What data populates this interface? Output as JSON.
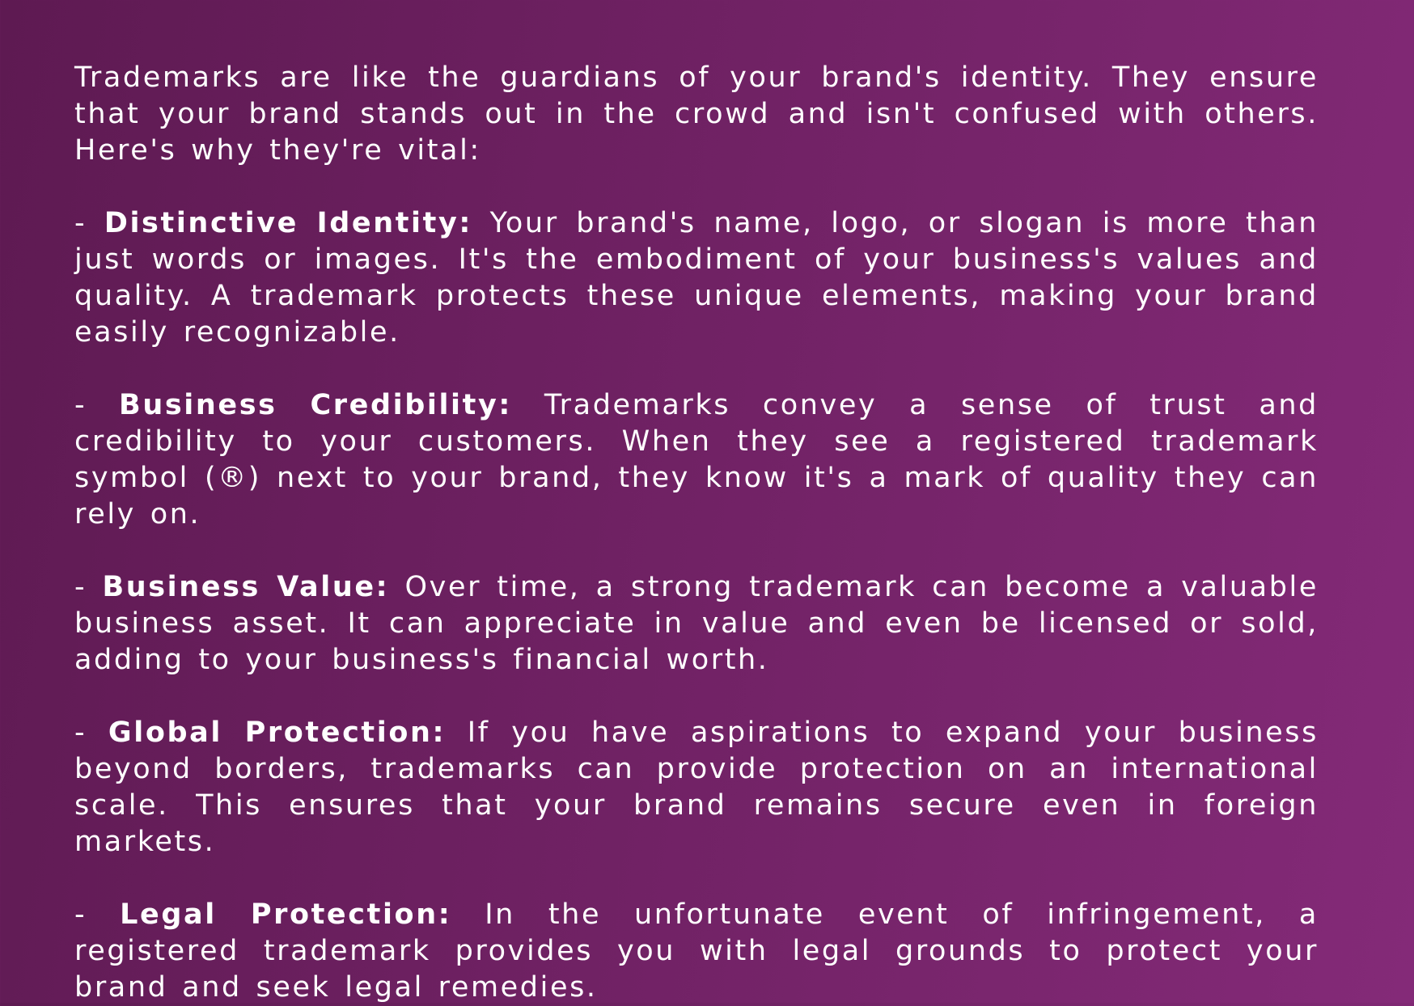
{
  "intro": "Trademarks are like the guardians of your brand's identity. They ensure that your brand stands out in the crowd and isn't confused with others. Here's why they're vital:",
  "points": [
    {
      "dash": "- ",
      "term": "Distinctive Identity:",
      "text": " Your brand's name, logo, or slogan is more than just words or images. It's the embodiment of your business's values and quality. A trademark protects these unique elements, making your brand easily recognizable."
    },
    {
      "dash": "- ",
      "term": "Business Credibility:",
      "text": " Trademarks convey a sense of trust and credibility to your customers. When they see a registered trademark symbol (®) next to your brand, they know it's a mark of quality they can rely on."
    },
    {
      "dash": "- ",
      "term": "Business Value:",
      "text": " Over time, a strong trademark can become a valuable business asset. It can appreciate in value and even be licensed or sold, adding to your business's financial worth."
    },
    {
      "dash": "- ",
      "term": "Global Protection:",
      "text": " If you have aspirations to expand your business beyond borders, trademarks can provide protection on an international scale. This ensures that your brand remains secure even in foreign markets."
    },
    {
      "dash": "- ",
      "term": "Legal Protection:",
      "text": " In the unfortunate event of infringement, a registered trademark provides you with legal grounds to protect your brand and seek legal remedies."
    }
  ],
  "colors": {
    "background_start": "#5e1a52",
    "background_end": "#842a78",
    "text": "#ffffff"
  }
}
